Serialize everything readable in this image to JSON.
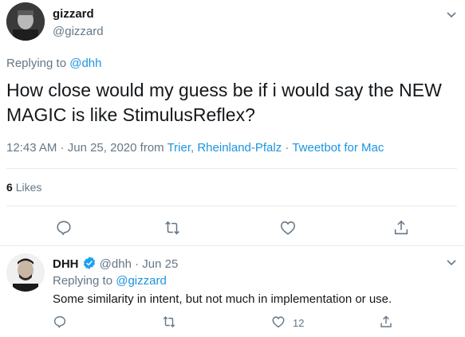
{
  "main_tweet": {
    "author_name": "gizzard",
    "author_handle": "@gizzard",
    "replying_prefix": "Replying to",
    "replying_handle": "@dhh",
    "text": "How close would my guess be if i would say the NEW MAGIC is like StimulusReflex?",
    "time": "12:43 AM",
    "date": "Jun 25, 2020",
    "from_label": "from",
    "location": "Trier, Rheinland-Pfalz",
    "source": "Tweetbot for Mac",
    "likes_count": "6",
    "likes_label": "Likes"
  },
  "reply_tweet": {
    "author_name": "DHH",
    "author_handle": "@dhh",
    "date": "Jun 25",
    "replying_prefix": "Replying to",
    "replying_handle": "@gizzard",
    "text": "Some similarity in intent, but not much in implementation or use.",
    "like_count": "12"
  },
  "icons": {
    "reply": "reply-icon",
    "retweet": "retweet-icon",
    "like": "heart-icon",
    "share": "share-icon",
    "more": "chevron-down-icon",
    "verified": "verified-badge-icon"
  },
  "colors": {
    "accent": "#1b95e0",
    "text_primary": "#14171a",
    "text_secondary": "#657786",
    "divider": "#e6ecf0"
  }
}
